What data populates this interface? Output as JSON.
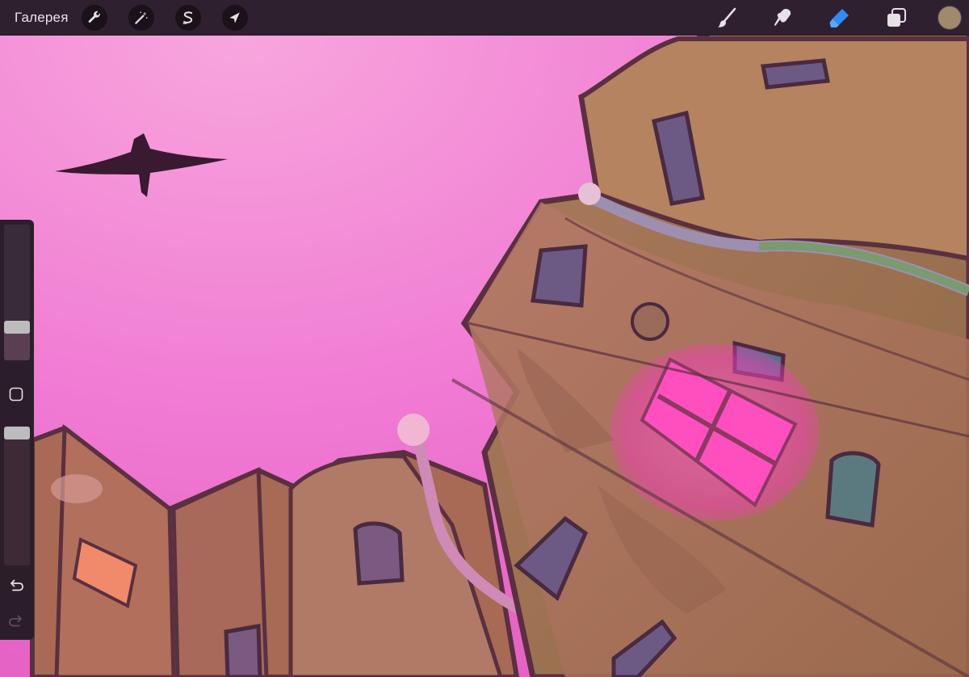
{
  "topbar": {
    "gallery_label": "Галерея",
    "left_tools": [
      {
        "name": "actions",
        "icon": "wrench-icon"
      },
      {
        "name": "adjustments",
        "icon": "magic-wand-icon"
      },
      {
        "name": "selection",
        "icon": "selection-s-icon"
      },
      {
        "name": "transform",
        "icon": "arrow-cursor-icon"
      }
    ],
    "right_tools": [
      {
        "name": "brush",
        "icon": "brush-icon",
        "active": false
      },
      {
        "name": "smudge",
        "icon": "smudge-icon",
        "active": false
      },
      {
        "name": "eraser",
        "icon": "eraser-icon",
        "active": true
      },
      {
        "name": "layers",
        "icon": "layers-icon",
        "active": false
      }
    ],
    "current_color": "#a08a6c"
  },
  "sidebar": {
    "brush_size": 0.22,
    "brush_opacity": 1.0,
    "modify_icon": "square-icon",
    "undo_icon": "undo-icon",
    "redo_icon": "redo-icon"
  },
  "colors": {
    "accent_active": "#2f8cf0",
    "icon": "#e6e0e7",
    "sky_light": "#f59ad8",
    "sky_pink": "#f06fd0",
    "window_glow": "#ff4fbf"
  }
}
